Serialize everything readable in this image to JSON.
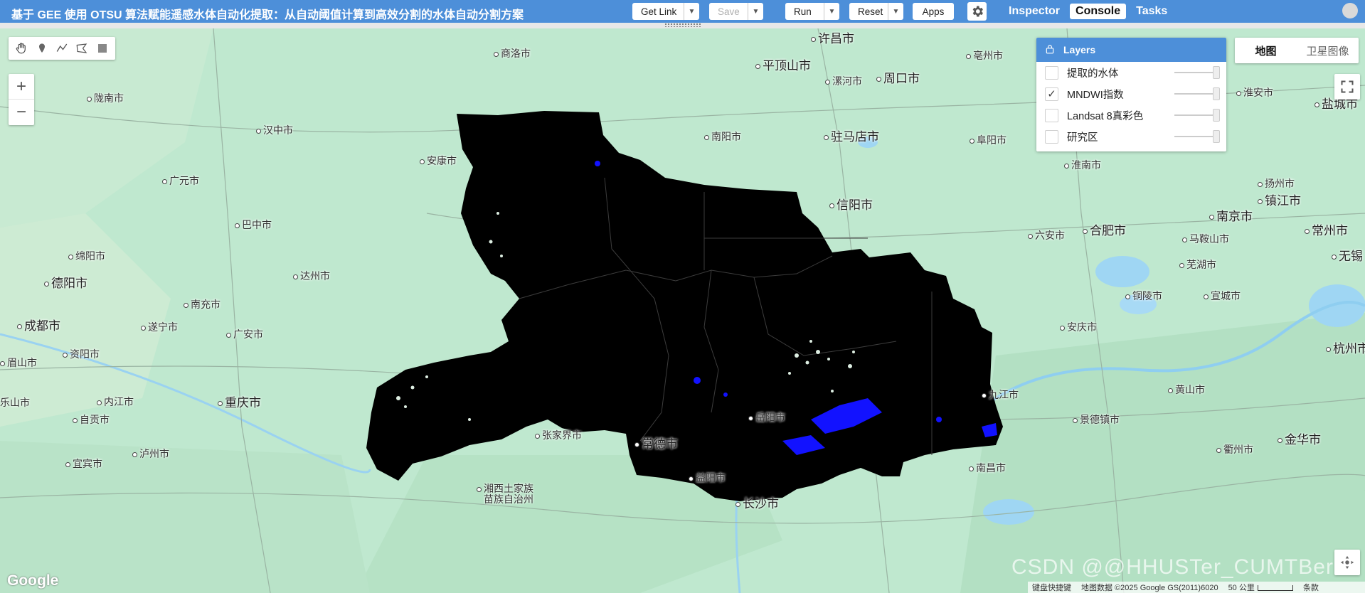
{
  "header": {
    "title": "基于 GEE 使用 OTSU 算法赋能遥感水体自动化提取：从自动阈值计算到高效分割的水体自动分割方案",
    "get_link": "Get Link",
    "save": "Save",
    "run": "Run",
    "reset": "Reset",
    "apps": "Apps",
    "tabs": [
      "Inspector",
      "Console",
      "Tasks"
    ],
    "active_tab": "Console"
  },
  "layers_panel": {
    "title": "Layers",
    "items": [
      {
        "label": "提取的水体",
        "checked": false
      },
      {
        "label": "MNDWI指数",
        "checked": true
      },
      {
        "label": "Landsat 8真彩色",
        "checked": false
      },
      {
        "label": "研究区",
        "checked": false
      }
    ]
  },
  "map_type": {
    "options": [
      "地图",
      "卫星图像"
    ],
    "selected": "地图"
  },
  "map_labels": {
    "cities": [
      "许昌市",
      "商洛市",
      "平顶山市",
      "周口市",
      "亳州市",
      "漯河市",
      "陇南市",
      "汉中市",
      "南阳市",
      "驻马店市",
      "阜阳市",
      "淮安市",
      "盐城市",
      "安康市",
      "广元市",
      "淮南市",
      "扬州市",
      "信阳市",
      "镇江市",
      "巴中市",
      "南京市",
      "六安市",
      "合肥市",
      "常州市",
      "马鞍山市",
      "绵阳市",
      "无锡",
      "德阳市",
      "达州市",
      "芜湖市",
      "南充市",
      "铜陵市",
      "宣城市",
      "成都市",
      "遂宁市",
      "广安市",
      "安庆市",
      "杭州市",
      "眉山市",
      "资阳市",
      "九江市",
      "黄山市",
      "内江市",
      "重庆市",
      "乐山市",
      "自贡市",
      "岳阳市",
      "景德镇市",
      "张家界市",
      "常德市",
      "金华市",
      "衢州市",
      "宜宾市",
      "泸州市",
      "益阳市",
      "南昌市",
      "湘西土家族",
      "苗族自治州",
      "长沙市"
    ]
  },
  "footer": {
    "google": "Google",
    "keyboard": "键盘快捷键",
    "map_data": "地图数据 ©2025 Google GS(2011)6020",
    "scale": "50 公里",
    "terms": "条款",
    "watermark": "CSDN @@HHUSTer_CUMTBer"
  },
  "colors": {
    "topbar": "#4d8fd9",
    "map_bg": "#bfe8cf",
    "mask": "#000000",
    "water": "#1212ff"
  }
}
